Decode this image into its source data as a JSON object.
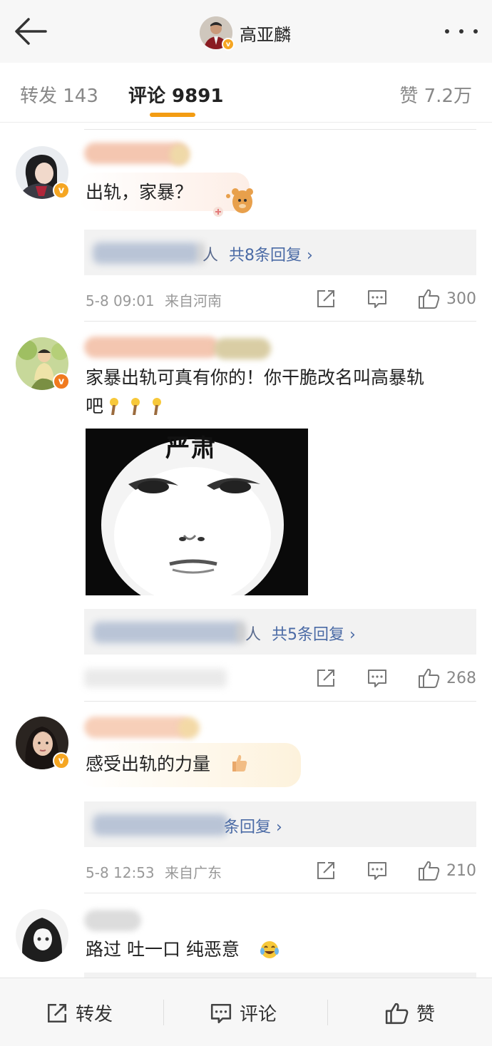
{
  "header": {
    "title": "高亚麟",
    "back_icon": "arrow-left-icon",
    "more_icon": "more-dots-icon"
  },
  "tabs": {
    "repost": "转发 143",
    "comment": "评论 9891",
    "like": "赞 7.2万",
    "active": "comment",
    "accent_color": "#f39c12"
  },
  "comments": [
    {
      "text": "出轨，家暴？",
      "reply_prefix": "人",
      "reply_link": "共8条回复 ›",
      "time": "5-8 09:01",
      "source": "来自河南",
      "likes": "300"
    },
    {
      "text_line1": "家暴出轨可真有你的！你干脆改名叫高暴轨",
      "text_line2": "吧",
      "meme_caption": "严肃",
      "reply_prefix": "人",
      "reply_link": "共5条回复 ›",
      "likes": "268"
    },
    {
      "text": "感受出轨的力量",
      "reply_link": "条回复 ›",
      "time": "5-8 12:53",
      "source": "来自广东",
      "likes": "210"
    },
    {
      "text": "路过 吐一口 纯恶意"
    }
  ],
  "bottom_bar": {
    "repost": "转发",
    "comment": "评论",
    "like": "赞"
  }
}
